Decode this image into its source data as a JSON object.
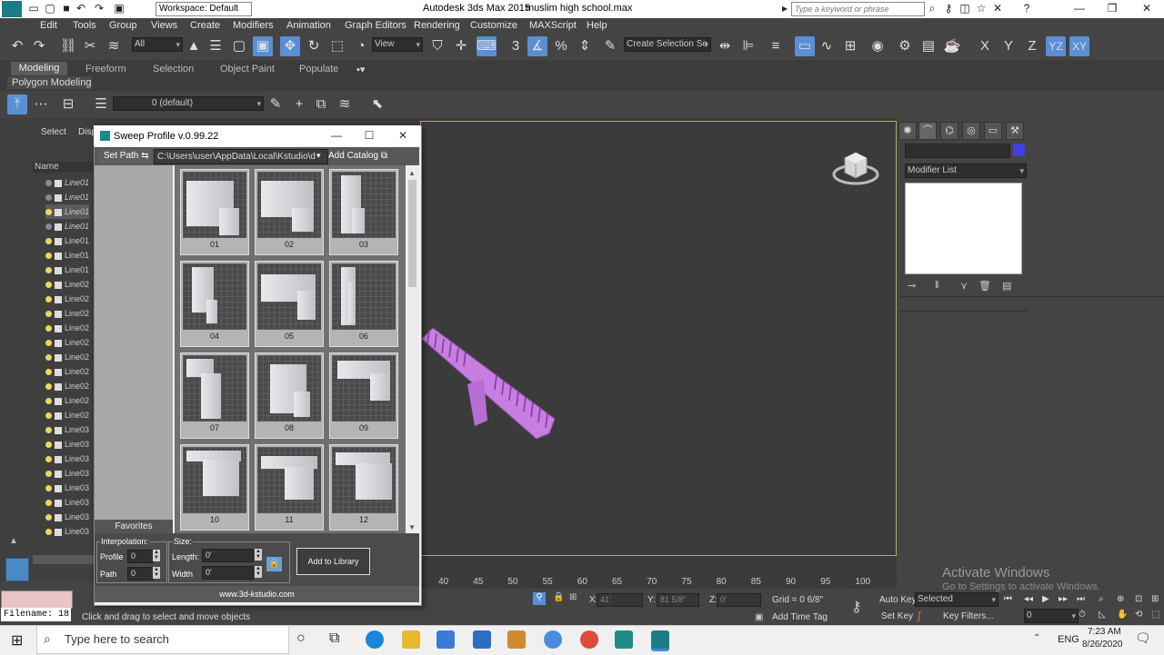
{
  "titlebar": {
    "workspace": "Workspace: Default",
    "app": "Autodesk 3ds Max  2015",
    "file": "muslim high school.max",
    "search_placeholder": "Type a keyword or phrase"
  },
  "menu": [
    "Edit",
    "Tools",
    "Group",
    "Views",
    "Create",
    "Modifiers",
    "Animation",
    "Graph Editors",
    "Rendering",
    "Customize",
    "MAXScript",
    "Help"
  ],
  "toolbar": {
    "filter": "All",
    "view": "View",
    "selection_set": "Create Selection Se",
    "axis_x": "X",
    "axis_y": "Y",
    "axis_z": "Z",
    "axis_yz": "YZ",
    "axis_xy": "XY"
  },
  "ribbon": {
    "tabs": [
      "Modeling",
      "Freeform",
      "Selection",
      "Object Paint",
      "Populate"
    ],
    "panel": "Polygon Modeling",
    "layer": "0 (default)"
  },
  "explorer": {
    "tabs": [
      "Select",
      "Disp"
    ],
    "header": "Name",
    "rows": [
      {
        "name": "Line01",
        "italic": true,
        "on": false
      },
      {
        "name": "Line01",
        "italic": true,
        "on": false
      },
      {
        "name": "Line01",
        "italic": true,
        "on": true
      },
      {
        "name": "Line01",
        "italic": true,
        "on": false
      },
      {
        "name": "Line01",
        "italic": false,
        "on": true
      },
      {
        "name": "Line01",
        "italic": false,
        "on": true
      },
      {
        "name": "Line01",
        "italic": false,
        "on": true
      },
      {
        "name": "Line02",
        "italic": false,
        "on": true
      },
      {
        "name": "Line02",
        "italic": false,
        "on": true
      },
      {
        "name": "Line02",
        "italic": false,
        "on": true
      },
      {
        "name": "Line02",
        "italic": false,
        "on": true
      },
      {
        "name": "Line02",
        "italic": false,
        "on": true
      },
      {
        "name": "Line02",
        "italic": false,
        "on": true
      },
      {
        "name": "Line02",
        "italic": false,
        "on": true
      },
      {
        "name": "Line02",
        "italic": false,
        "on": true
      },
      {
        "name": "Line02",
        "italic": false,
        "on": true
      },
      {
        "name": "Line02",
        "italic": false,
        "on": true
      },
      {
        "name": "Line03",
        "italic": false,
        "on": true
      },
      {
        "name": "Line03",
        "italic": false,
        "on": true
      },
      {
        "name": "Line03",
        "italic": false,
        "on": true
      },
      {
        "name": "Line03",
        "italic": false,
        "on": true
      },
      {
        "name": "Line03",
        "italic": false,
        "on": true
      },
      {
        "name": "Line03",
        "italic": false,
        "on": true
      },
      {
        "name": "Line03",
        "italic": false,
        "on": true
      },
      {
        "name": "Line03",
        "italic": false,
        "on": true
      }
    ]
  },
  "command_panel": {
    "modifier_list": "Modifier List"
  },
  "sweep_dialog": {
    "title": "Sweep Profile v.0.99.22",
    "set_path": "Set Path",
    "path": "C:\\Users\\user\\AppData\\Local\\Kstudio\\d",
    "add_catalog": "Add Catalog",
    "favorites": "Favorites",
    "profiles": [
      "01",
      "02",
      "03",
      "04",
      "05",
      "06",
      "07",
      "08",
      "09",
      "10",
      "11",
      "12"
    ],
    "interpolation_label": "Interpolation:",
    "profile_label": "Profile",
    "profile_value": "0",
    "path_label": "Path",
    "path_value": "0",
    "size_label": "Size:",
    "length_label": "Length:",
    "length_value": "0'",
    "width_label": "Width",
    "width_value": "0'",
    "add_button": "Add to Library",
    "footer": "www.3d-kstudio.com"
  },
  "timeline": {
    "ticks": [
      "40",
      "45",
      "50",
      "55",
      "60",
      "65",
      "70",
      "75",
      "80",
      "85",
      "90",
      "95",
      "100"
    ]
  },
  "status": {
    "filename": "Filename: 18",
    "prompt": "Click and drag to select and move objects",
    "x_label": "X:",
    "x_value": "41'",
    "y_label": "Y:",
    "y_value": "81 5/8\"",
    "z_label": "Z:",
    "z_value": "0'",
    "grid": "Grid = 0 6/8\"",
    "add_time_tag": "Add Time Tag",
    "auto_key": "Auto Key",
    "selected": "Selected",
    "set_key": "Set Key",
    "key_filters": "Key Filters...",
    "frame": "0",
    "activate_title": "Activate Windows",
    "activate_sub": "Go to Settings to activate Windows."
  },
  "taskbar": {
    "search": "Type here to search",
    "lang": "ENG",
    "time": "7:23 AM",
    "date": "8/26/2020"
  },
  "colors": {
    "accent": "#5a8fd6",
    "viewport_border": "#c8a73a",
    "object_color": "#c77ee0"
  }
}
